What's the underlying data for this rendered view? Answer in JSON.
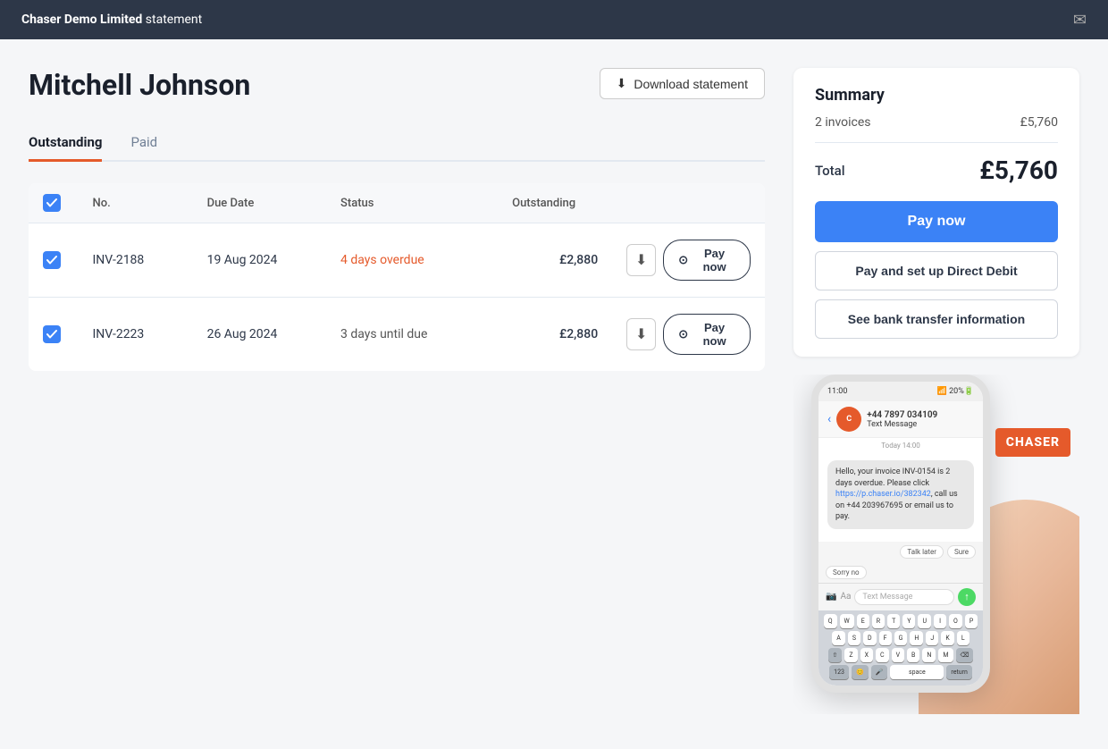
{
  "header": {
    "title_prefix": "Chaser Demo Limited",
    "title_suffix": " statement"
  },
  "customer": {
    "name": "Mitchell Johnson"
  },
  "toolbar": {
    "download_label": "Download statement"
  },
  "tabs": [
    {
      "label": "Outstanding",
      "active": true
    },
    {
      "label": "Paid",
      "active": false
    }
  ],
  "table": {
    "headers": [
      "No.",
      "Due Date",
      "Status",
      "Outstanding"
    ],
    "rows": [
      {
        "id": "INV-2188",
        "due_date": "19 Aug 2024",
        "status": "4 days overdue",
        "status_type": "overdue",
        "outstanding": "£2,880"
      },
      {
        "id": "INV-2223",
        "due_date": "26 Aug 2024",
        "status": "3 days until due",
        "status_type": "pending",
        "outstanding": "£2,880"
      }
    ]
  },
  "summary": {
    "title": "Summary",
    "invoice_count": "2 invoices",
    "invoice_total": "£5,760",
    "total_label": "Total",
    "total_amount": "£5,760",
    "btn_pay_now": "Pay now",
    "btn_direct_debit": "Pay and set up Direct Debit",
    "btn_bank_info": "See bank transfer information"
  },
  "phone": {
    "time": "11:00",
    "contact_number": "+44 7897 034109",
    "contact_label": "Text Message",
    "today_label": "Today 14:00",
    "message": "Hello, your invoice INV-0154 is 2 days overdue. Please click https://p.chaser.io/382342, call us on +44 203967695 or email us to pay.",
    "message_link": "https://p.chaser.io/382342",
    "input_placeholder": "Text Message",
    "quick_replies": [
      "Sorry no",
      "Talk later",
      "Sure"
    ],
    "chaser_label": "CHASER"
  },
  "icons": {
    "download": "⬇",
    "email": "✉",
    "check": "✓",
    "circle_check": "⊙",
    "back_arrow": "‹",
    "send": "↑"
  }
}
